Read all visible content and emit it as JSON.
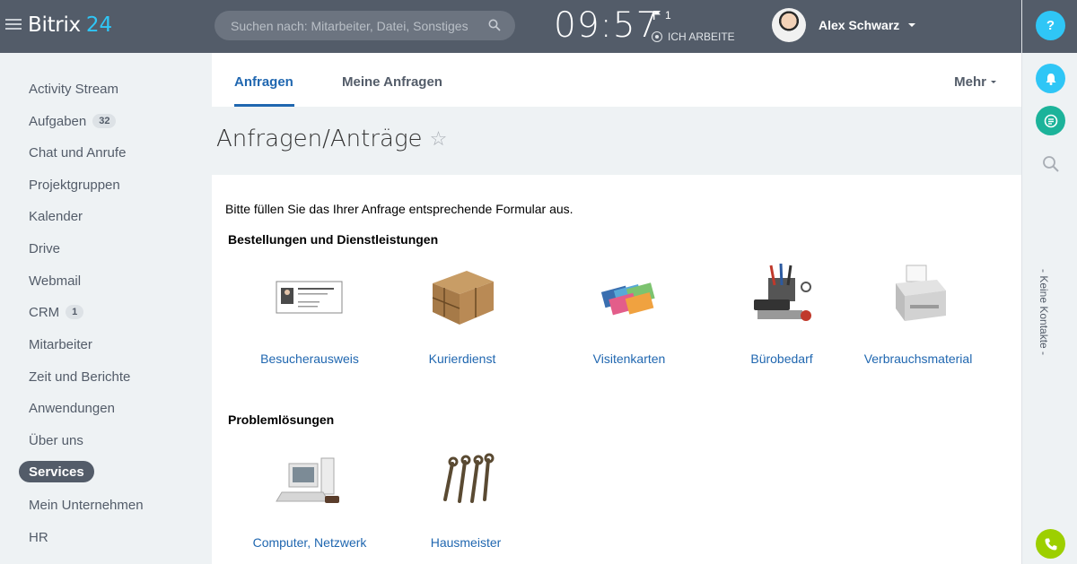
{
  "header": {
    "logo_name": "Bitrix",
    "logo_number": "24",
    "search_placeholder": "Suchen nach: Mitarbeiter, Datei, Sonstiges",
    "clock": "09:57",
    "flag_count": "1",
    "work_status": "ICH ARBEITE",
    "user_name": "Alex Schwarz"
  },
  "sidebar": {
    "items": [
      {
        "label": "Activity Stream"
      },
      {
        "label": "Aufgaben",
        "counter": "32"
      },
      {
        "label": "Chat und Anrufe"
      },
      {
        "label": "Projektgruppen"
      },
      {
        "label": "Kalender"
      },
      {
        "label": "Drive"
      },
      {
        "label": "Webmail"
      },
      {
        "label": "CRM",
        "counter": "1"
      },
      {
        "label": "Mitarbeiter"
      },
      {
        "label": "Zeit und Berichte"
      },
      {
        "label": "Anwendungen"
      },
      {
        "label": "Über uns"
      },
      {
        "label": "Services",
        "active": true
      },
      {
        "label": "Mein Unternehmen"
      },
      {
        "label": "HR"
      }
    ]
  },
  "tabs": {
    "items": [
      "Anfragen",
      "Meine Anfragen"
    ],
    "more": "Mehr"
  },
  "page": {
    "title": "Anfragen/Anträge",
    "intro": "Bitte füllen Sie das Ihrer Anfrage entsprechende Formular aus.",
    "sections": [
      {
        "title": "Bestellungen und Dienstleistungen",
        "services": [
          "Besucherausweis",
          "Kurierdienst",
          "Visitenkarten",
          "Bürobedarf",
          "Verbrauchsmaterial"
        ]
      },
      {
        "title": "Problemlösungen",
        "services": [
          "Computer, Netzwerk",
          "Hausmeister"
        ]
      }
    ]
  },
  "rightbar": {
    "help": "?",
    "contacts": "- Keine Kontakte -"
  },
  "colors": {
    "header_bg": "#535c69",
    "accent_blue": "#2fc6f6",
    "link_blue": "#2067b0",
    "chat_green": "#1cb39a",
    "phone_green": "#9dcf00"
  }
}
